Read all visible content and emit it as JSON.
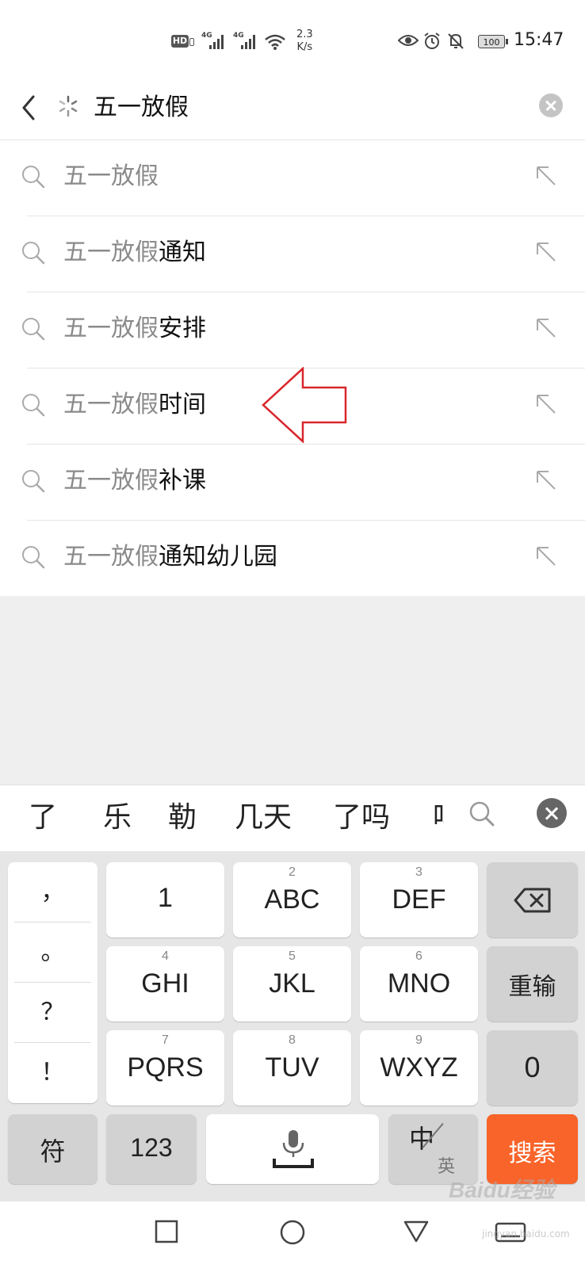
{
  "status_bar": {
    "hd": "HD",
    "net1": "4G",
    "net2": "4G",
    "speed_value": "2.3",
    "speed_unit": "K/s",
    "battery": "100",
    "time": "15:47"
  },
  "search": {
    "query": "五一放假"
  },
  "suggestions": [
    {
      "prefix": "五一放假",
      "suffix": ""
    },
    {
      "prefix": "五一放假",
      "suffix": "通知"
    },
    {
      "prefix": "五一放假",
      "suffix": "安排"
    },
    {
      "prefix": "五一放假",
      "suffix": "时间"
    },
    {
      "prefix": "五一放假",
      "suffix": "补课"
    },
    {
      "prefix": "五一放假",
      "suffix": "通知幼儿园"
    }
  ],
  "candidates": [
    "了",
    "乐",
    "勒",
    "几天",
    "了吗",
    "吗"
  ],
  "keyboard": {
    "punctuation": [
      "，",
      "。",
      "？",
      "！"
    ],
    "rows": [
      [
        {
          "num": "",
          "label": "1"
        },
        {
          "num": "2",
          "label": "ABC"
        },
        {
          "num": "3",
          "label": "DEF"
        }
      ],
      [
        {
          "num": "4",
          "label": "GHI"
        },
        {
          "num": "5",
          "label": "JKL"
        },
        {
          "num": "6",
          "label": "MNO"
        }
      ],
      [
        {
          "num": "7",
          "label": "PQRS"
        },
        {
          "num": "8",
          "label": "TUV"
        },
        {
          "num": "9",
          "label": "WXYZ"
        }
      ]
    ],
    "reenter": "重输",
    "zero": "0",
    "symbols": "符",
    "numbers": "123",
    "lang_cn": "中",
    "lang_en": "英",
    "search": "搜索"
  },
  "watermark": {
    "brand": "Baidu经验",
    "url": "jingyan.baidu.com"
  },
  "colors": {
    "search_key": "#f8642a",
    "annotation_arrow": "#d9262c",
    "prefix_gray": "#8a8a8a"
  }
}
